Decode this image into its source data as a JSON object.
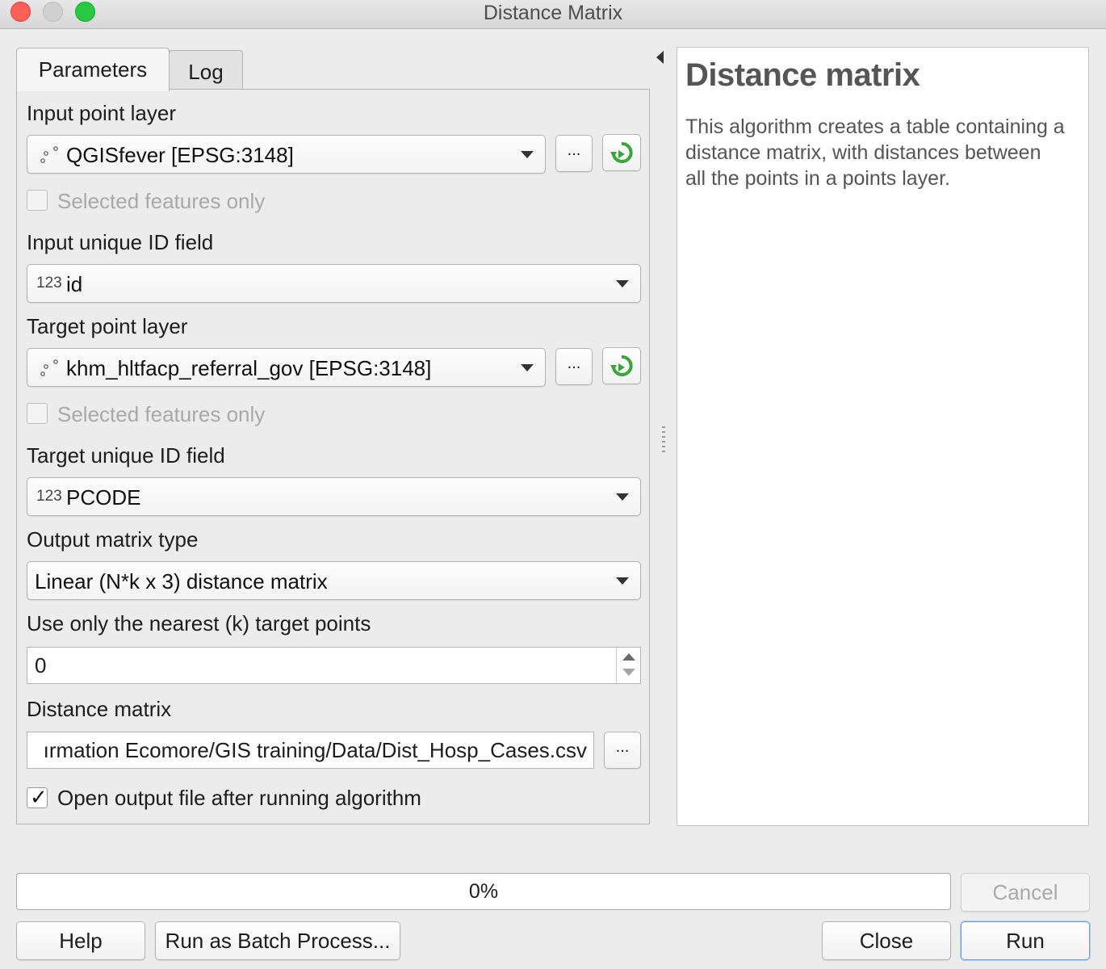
{
  "window": {
    "title": "Distance Matrix"
  },
  "tabs": [
    {
      "label": "Parameters"
    },
    {
      "label": "Log"
    }
  ],
  "params": {
    "input_layer_label": "Input point layer",
    "input_layer_value": "QGISfever [EPSG:3148]",
    "input_selected_label": "Selected features only",
    "input_id_label": "Input unique ID field",
    "input_id_type": "123",
    "input_id_value": "id",
    "target_layer_label": "Target point layer",
    "target_layer_value": "khm_hltfacp_referral_gov [EPSG:3148]",
    "target_selected_label": "Selected features only",
    "target_id_label": "Target unique ID field",
    "target_id_type": "123",
    "target_id_value": "PCODE",
    "matrix_type_label": "Output matrix type",
    "matrix_type_value": "Linear (N*k x 3) distance matrix",
    "nearest_label": "Use only the nearest (k) target points",
    "nearest_value": "0",
    "output_label": "Distance matrix",
    "output_value": "ırmation Ecomore/GIS training/Data/Dist_Hosp_Cases.csv",
    "open_output_label": "Open output file after running algorithm",
    "open_output_checked": true,
    "browse_label": "..."
  },
  "help": {
    "title": "Distance matrix",
    "text": "This algorithm creates a table containing a distance matrix, with distances between all the points in a points layer."
  },
  "progress": {
    "text": "0%",
    "value": 0
  },
  "buttons": {
    "cancel": "Cancel",
    "help": "Help",
    "batch": "Run as Batch Process...",
    "close": "Close",
    "run": "Run"
  },
  "colors": {
    "close": "#fe5f57",
    "minimize": "#d0d0d0",
    "maximize": "#28c840",
    "refresh_icon": "#3aa63a"
  },
  "icons": [
    "point-layer-icon",
    "integer-field-icon",
    "refresh-layer-icon",
    "collapse-arrow-icon"
  ]
}
